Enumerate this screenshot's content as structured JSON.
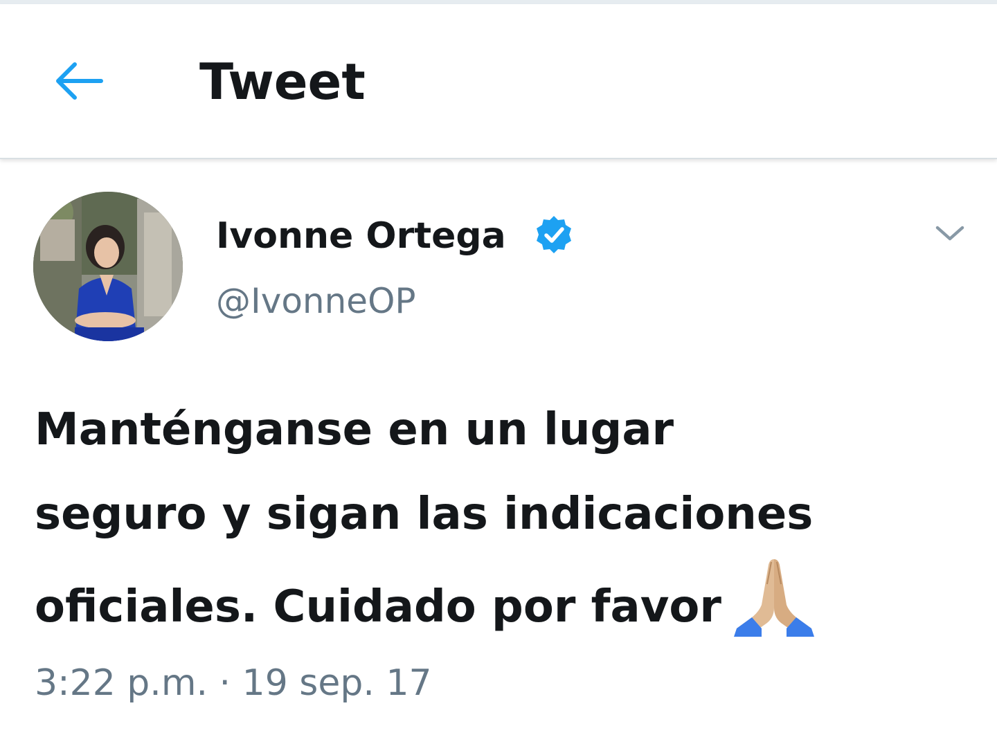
{
  "header": {
    "back_icon": "arrow-left-icon",
    "title": "Tweet"
  },
  "tweet": {
    "author": {
      "display_name": "Ivonne Ortega",
      "handle": "@IvonneOP",
      "verified": true,
      "avatar_icon": "avatar-photo"
    },
    "more_icon": "chevron-down-icon",
    "text_lines": [
      "Manténganse en un lugar",
      "seguro y sigan las indicaciones",
      "oficiales. Cuidado por favor"
    ],
    "emoji": "folded-hands-icon",
    "timestamp": "3:22 p.m. · 19 sep. 17"
  },
  "colors": {
    "accent": "#1da1f2",
    "text_primary": "#14171a",
    "text_secondary": "#657786",
    "divider": "#d9dfe3"
  }
}
